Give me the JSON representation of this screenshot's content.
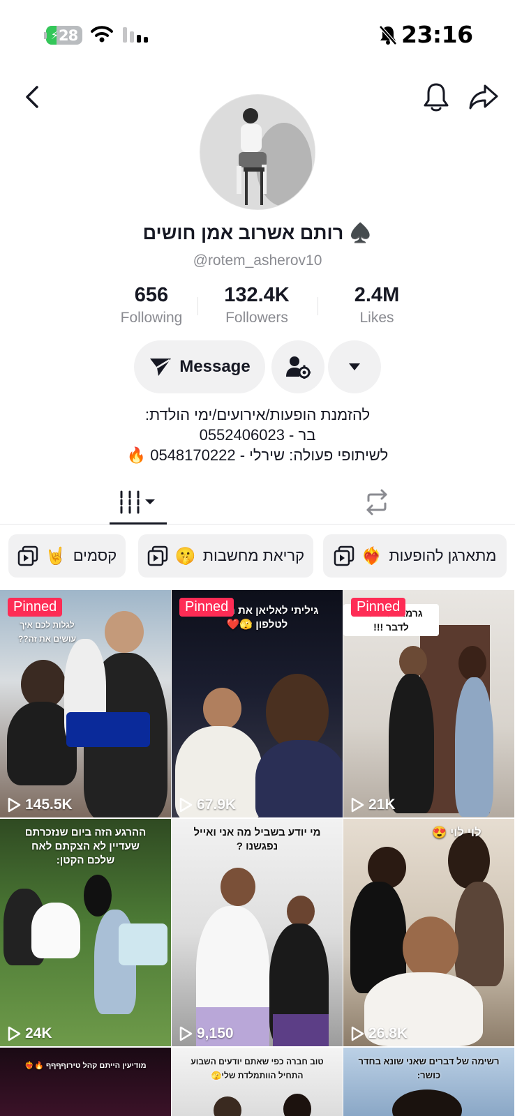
{
  "status_bar": {
    "battery_level": 28,
    "battery_text": "28",
    "time": "23:16"
  },
  "profile": {
    "display_name": "♠️ רותם אשרוב אמן חושים",
    "username": "@rotem_asherov10",
    "stats": [
      {
        "value": "656",
        "label": "Following"
      },
      {
        "value": "132.4K",
        "label": "Followers"
      },
      {
        "value": "2.4M",
        "label": "Likes"
      }
    ],
    "message_label": "Message",
    "bio_lines": [
      "להזמנת הופעות/אירועים/ימי הולדת:",
      "בר - 0552406023",
      "לשיתופי פעולה: שירלי - 0548170222 🔥"
    ]
  },
  "playlists": [
    {
      "label": "מתארגן להופעות",
      "emoji": "❤️‍🔥"
    },
    {
      "label": "קריאת מחשבות",
      "emoji": "🤫"
    },
    {
      "label": "קסמים",
      "emoji": "🤘"
    }
  ],
  "videos": [
    {
      "pinned": "Pinned",
      "views": "145.5K",
      "caption": "לגלות לכם איך עושים את זה??"
    },
    {
      "pinned": "Pinned",
      "views": "67.9K",
      "caption": "גיליתי לאליאן את הסיסמא לטלפון 🫣❤️"
    },
    {
      "pinned": "Pinned",
      "views": "21K",
      "caption": "גרמתי להצליח לדבר !!!"
    },
    {
      "pinned": "",
      "views": "24K",
      "caption": "ההרגע הזה ביום שנזכרתם שעדיין לא הצקתם לאח שלכם הקטן:"
    },
    {
      "pinned": "",
      "views": "9,150",
      "caption": "מי יודע בשביל מה אני ואייל נפגשנו ?"
    },
    {
      "pinned": "",
      "views": "26.8K",
      "caption": "לוי לוי 😍"
    },
    {
      "pinned": "",
      "views": "",
      "caption": "מודיעין הייתם קהל טירוףףףף 🔥❤️‍🔥"
    },
    {
      "pinned": "",
      "views": "",
      "caption": "טוב חברה כפי שאתם יודעים השבוע התחיל הוותמלדת שלי🫣"
    },
    {
      "pinned": "",
      "views": "",
      "caption": "רשימה של דברים שאני שונא בחדר כושר:"
    }
  ],
  "colors": {
    "accent": "#fe2c55",
    "text_primary": "#161823",
    "text_secondary": "#8a8b91",
    "button_bg": "#f1f1f2",
    "battery_fill": "#34c759"
  }
}
